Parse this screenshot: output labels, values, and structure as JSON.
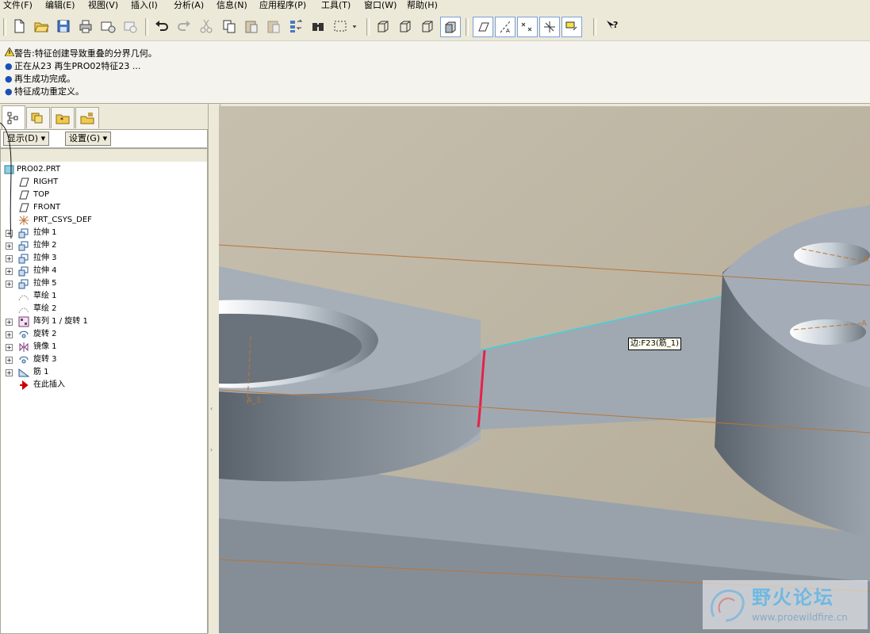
{
  "menu": [
    "文件(F)",
    "编辑(E)",
    "视图(V)",
    "插入(I)",
    "分析(A)",
    "信息(N)",
    "应用程序(P)",
    "工具(T)",
    "窗口(W)",
    "帮助(H)"
  ],
  "toolbar": {
    "icons": [
      "new-file-icon",
      "open-folder-icon",
      "save-icon",
      "print-icon",
      "send-mail-icon",
      "erase-icon",
      "undo-icon",
      "redo-icon",
      "cut-icon",
      "copy-icon",
      "paste-icon",
      "paste-special-icon",
      "regenerate-icon",
      "find-icon",
      "select-box-icon",
      "shaded-mode-icon",
      "wireframe-icon",
      "hidden-line-icon",
      "no-hidden-icon",
      "datum-planes-icon",
      "datum-axes-icon",
      "datum-points-icon",
      "coord-sys-icon",
      "annotations-icon",
      "context-help-icon"
    ]
  },
  "messages": [
    {
      "type": "warning",
      "text": "警告:特征创建导致重叠的分界几何。"
    },
    {
      "type": "info",
      "text": "正在从23 再生PRO02特征23 ..."
    },
    {
      "type": "info",
      "text": "再生成功完成。"
    },
    {
      "type": "info",
      "text": "特征成功重定义。"
    }
  ],
  "panel": {
    "tabs": [
      "model-tree-tab",
      "layers-tab",
      "favorites-tab",
      "connections-tab"
    ],
    "show_label": "显示(D)",
    "settings_label": "设置(G)"
  },
  "tree": {
    "root": "PRO02.PRT",
    "items": [
      {
        "label": "RIGHT",
        "icon": "datum-plane-icon",
        "expandable": false,
        "greyed": false
      },
      {
        "label": "TOP",
        "icon": "datum-plane-icon",
        "expandable": false,
        "greyed": false
      },
      {
        "label": "FRONT",
        "icon": "datum-plane-icon",
        "expandable": false,
        "greyed": false
      },
      {
        "label": "PRT_CSYS_DEF",
        "icon": "csys-icon",
        "expandable": false,
        "greyed": false
      },
      {
        "label": "拉伸 1",
        "icon": "extrude-icon",
        "expandable": true,
        "greyed": false
      },
      {
        "label": "拉伸 2",
        "icon": "extrude-icon",
        "expandable": true,
        "greyed": false
      },
      {
        "label": "拉伸 3",
        "icon": "extrude-icon",
        "expandable": true,
        "greyed": false
      },
      {
        "label": "拉伸 4",
        "icon": "extrude-icon",
        "expandable": true,
        "greyed": false
      },
      {
        "label": "拉伸 5",
        "icon": "extrude-icon",
        "expandable": true,
        "greyed": false
      },
      {
        "label": "草绘 1",
        "icon": "sketch-icon",
        "expandable": false,
        "greyed": true
      },
      {
        "label": "草绘 2",
        "icon": "sketch-icon",
        "expandable": false,
        "greyed": true
      },
      {
        "label": "阵列 1 / 旋转 1",
        "icon": "pattern-icon",
        "expandable": true,
        "greyed": false
      },
      {
        "label": "旋转 2",
        "icon": "revolve-icon",
        "expandable": true,
        "greyed": false
      },
      {
        "label": "镜像 1",
        "icon": "mirror-icon",
        "expandable": true,
        "greyed": false
      },
      {
        "label": "旋转 3",
        "icon": "revolve-icon",
        "expandable": true,
        "greyed": false
      },
      {
        "label": "筋 1",
        "icon": "rib-icon",
        "expandable": true,
        "greyed": false
      },
      {
        "label": "在此插入",
        "icon": "insert-here-icon",
        "expandable": false,
        "greyed": false
      }
    ]
  },
  "viewport": {
    "tooltip": "边:F23(筋_1)",
    "axis_labels": [
      "A_1",
      "A",
      "A"
    ],
    "colors": {
      "background": "#bdb49f",
      "part": "#a4adb7",
      "highlight_edge": "#e8204a",
      "selected_edge": "#40d0e0",
      "datum": "#b8743a"
    }
  },
  "watermark": {
    "title": "野火论坛",
    "url": "www.proewildfire.cn"
  }
}
